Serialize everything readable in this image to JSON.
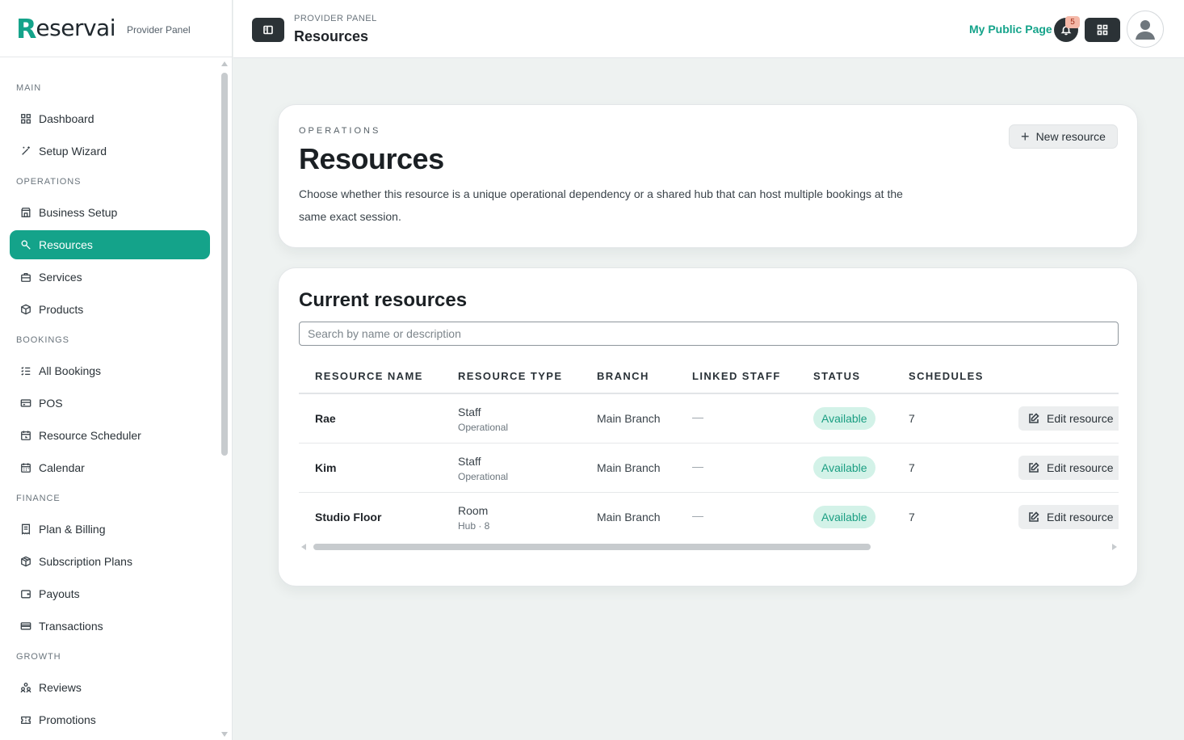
{
  "brand": {
    "logo_first": "R",
    "logo_rest": "eservai",
    "subtitle": "Provider Panel"
  },
  "sidebar": {
    "sections": [
      {
        "title": "MAIN",
        "items": [
          {
            "label": "Dashboard",
            "icon": "dashboard-grid-icon"
          },
          {
            "label": "Setup Wizard",
            "icon": "magic-wand-icon"
          }
        ]
      },
      {
        "title": "OPERATIONS",
        "items": [
          {
            "label": "Business Setup",
            "icon": "store-icon"
          },
          {
            "label": "Resources",
            "icon": "wrench-icon",
            "active": true
          },
          {
            "label": "Services",
            "icon": "briefcase-icon"
          },
          {
            "label": "Products",
            "icon": "package-icon"
          }
        ]
      },
      {
        "title": "BOOKINGS",
        "items": [
          {
            "label": "All Bookings",
            "icon": "list-check-icon"
          },
          {
            "label": "POS",
            "icon": "credit-card-icon"
          },
          {
            "label": "Resource Scheduler",
            "icon": "calendar-clock-icon"
          },
          {
            "label": "Calendar",
            "icon": "calendar-icon"
          }
        ]
      },
      {
        "title": "FINANCE",
        "items": [
          {
            "label": "Plan & Billing",
            "icon": "receipt-icon"
          },
          {
            "label": "Subscription Plans",
            "icon": "box-icon"
          },
          {
            "label": "Payouts",
            "icon": "wallet-icon"
          },
          {
            "label": "Transactions",
            "icon": "card-icon"
          }
        ]
      },
      {
        "title": "GROWTH",
        "items": [
          {
            "label": "Reviews",
            "icon": "people-icon"
          },
          {
            "label": "Promotions",
            "icon": "ticket-icon"
          }
        ]
      }
    ]
  },
  "topbar": {
    "eyebrow": "PROVIDER PANEL",
    "title": "Resources",
    "public_link": "My Public Page",
    "notification_count": "5"
  },
  "hero": {
    "eyebrow": "OPERATIONS",
    "title": "Resources",
    "description": "Choose whether this resource is a unique operational dependency or a shared hub that can host multiple bookings at the same exact session.",
    "new_button": "New resource"
  },
  "list": {
    "title": "Current resources",
    "search_placeholder": "Search by name or description",
    "columns": [
      "RESOURCE NAME",
      "RESOURCE TYPE",
      "BRANCH",
      "LINKED STAFF",
      "STATUS",
      "SCHEDULES"
    ],
    "edit_label": "Edit resource",
    "rows": [
      {
        "name": "Rae",
        "type": "Staff",
        "type_sub": "Operational",
        "branch": "Main Branch",
        "staff": "—",
        "status": "Available",
        "schedules": "7"
      },
      {
        "name": "Kim",
        "type": "Staff",
        "type_sub": "Operational",
        "branch": "Main Branch",
        "staff": "—",
        "status": "Available",
        "schedules": "7"
      },
      {
        "name": "Studio Floor",
        "type": "Room",
        "type_sub": "Hub · 8",
        "branch": "Main Branch",
        "staff": "—",
        "status": "Available",
        "schedules": "7"
      }
    ]
  },
  "colors": {
    "accent": "#14a38a",
    "dark_button": "#2b3236",
    "status_bg": "#d3f2e8",
    "page_bg": "#eef2f1"
  }
}
